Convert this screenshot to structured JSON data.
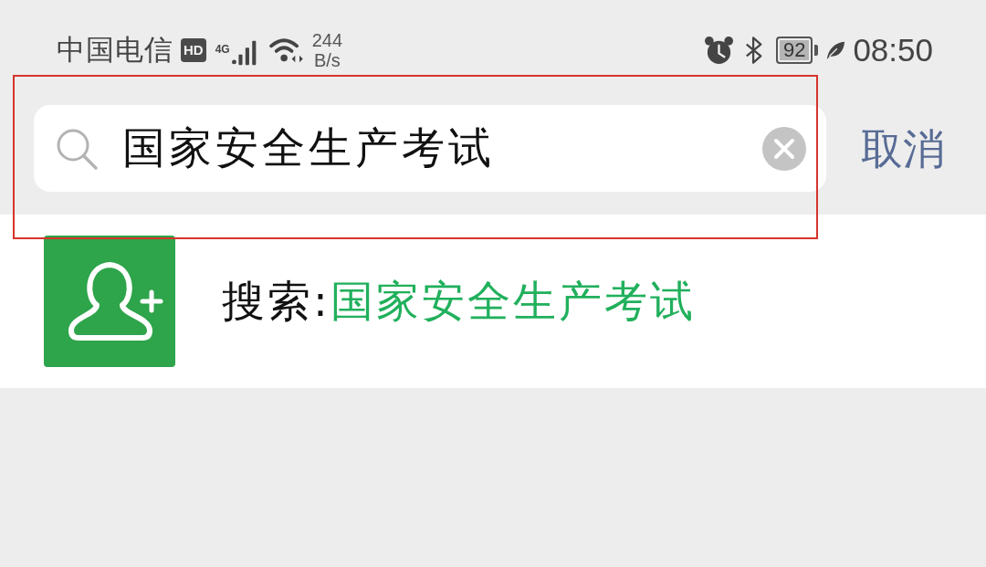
{
  "status_bar": {
    "carrier": "中国电信",
    "network_badge": "HD",
    "network_type": "4G",
    "speed_value": "244",
    "speed_unit": "B/s",
    "battery": "92",
    "time": "08:50"
  },
  "search_bar": {
    "value": "国家安全生产考试",
    "highlighted": true,
    "cancel": "取消"
  },
  "results": [
    {
      "kind": "add_contact",
      "prefix": "搜索:",
      "query": "国家安全生产考试"
    }
  ]
}
